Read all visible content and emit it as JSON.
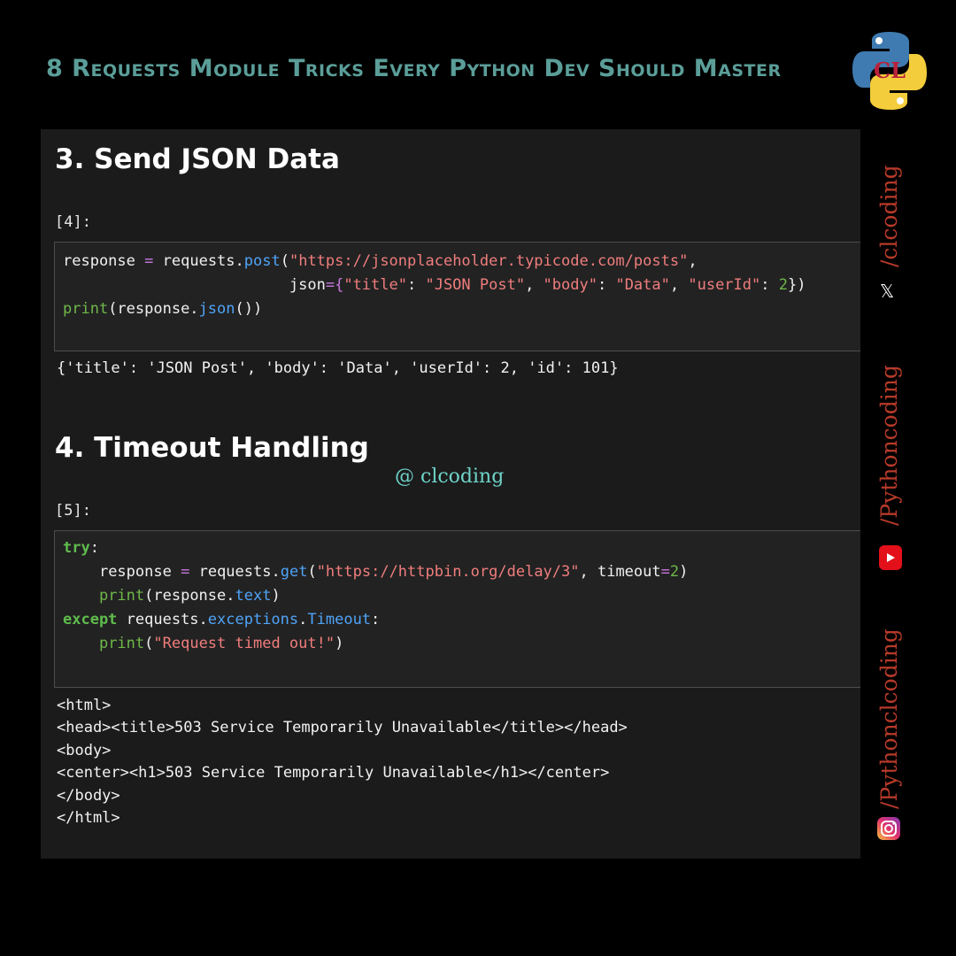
{
  "header": {
    "title": "8 Requests Module Tricks Every Python Dev Should Master"
  },
  "sections": [
    {
      "heading": "3. Send JSON Data",
      "prompt": "[4]:",
      "output": "{'title': 'JSON Post', 'body': 'Data', 'userId': 2, 'id': 101}"
    },
    {
      "heading": "4. Timeout Handling",
      "prompt": "[5]:",
      "output_lines": [
        "<html>",
        "<head><title>503 Service Temporarily Unavailable</title></head>",
        "<body>",
        "<center><h1>503 Service Temporarily Unavailable</h1></center>",
        "</body>",
        "</html>"
      ]
    }
  ],
  "code": {
    "cell4": {
      "l1": {
        "var": "response",
        "op": "=",
        "obj": "requests.",
        "fn": "post",
        "open": "(",
        "url": "\"https://jsonplaceholder.typicode.com/posts\"",
        "comma": ","
      },
      "l2": {
        "indent": "                         ",
        "kw": "json",
        "op": "=",
        "brace": "{",
        "k1": "\"title\"",
        "c1": ": ",
        "v1": "\"JSON Post\"",
        "s1": ", ",
        "k2": "\"body\"",
        "c2": ": ",
        "v2": "\"Data\"",
        "s2": ", ",
        "k3": "\"userId\"",
        "c3": ": ",
        "v3": "2",
        "close": "})"
      },
      "l3": {
        "bi": "print",
        "open": "(response.",
        "fn": "json",
        "close": "())"
      }
    },
    "cell5": {
      "l1": {
        "kw": "try",
        "colon": ":"
      },
      "l2": {
        "indent": "    ",
        "var": "response",
        "op": "=",
        "obj": "requests.",
        "fn": "get",
        "open": "(",
        "url": "\"https://httpbin.org/delay/3\"",
        "mid": ", timeout",
        "op2": "=",
        "num": "2",
        "close": ")"
      },
      "l3": {
        "indent": "    ",
        "bi": "print",
        "open": "(response.",
        "fn": "text",
        "close": ")"
      },
      "l4": {
        "kw": "except",
        "obj": " requests.",
        "mod": "exceptions",
        "dot": ".",
        "cls": "Timeout",
        "colon": ":"
      },
      "l5": {
        "indent": "    ",
        "bi": "print",
        "open": "(",
        "str": "\"Request timed out!\"",
        "close": ")"
      }
    }
  },
  "watermark": "@ clcoding",
  "social": {
    "handle_x": "/clcoding",
    "handle_youtube": "/Pythoncoding",
    "handle_instagram": "/Pythonclcoding",
    "x_icon_glyph": "𝕏",
    "logo_text": "CL"
  },
  "colors": {
    "title": "#5b9e99",
    "side_text": "#b83a2a",
    "keyword": "#5fbb4d",
    "string": "#f07d7d",
    "function": "#4fa3f7",
    "operator": "#c678dd",
    "watermark": "#6fd3c8"
  }
}
